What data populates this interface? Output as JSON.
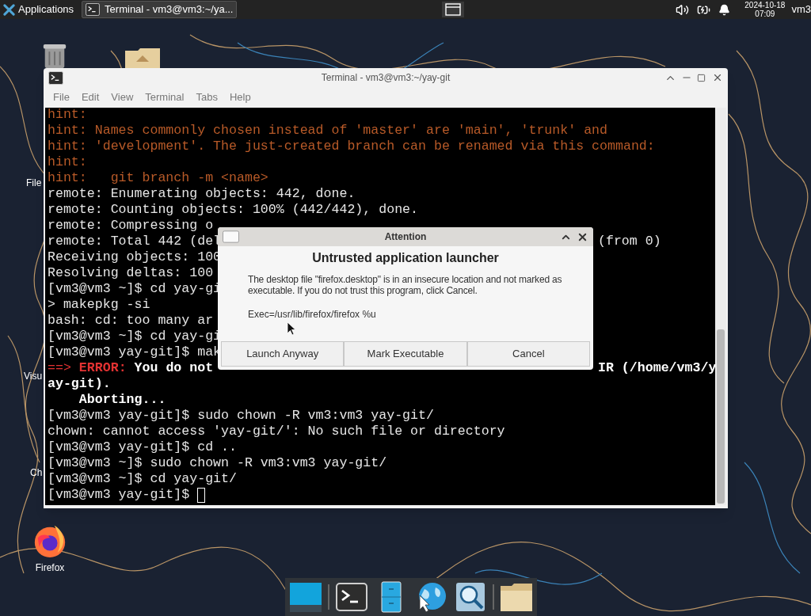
{
  "top_panel": {
    "menu_label": "Applications",
    "task": {
      "label": "Terminal - vm3@vm3:~/ya...",
      "selected": true
    },
    "date": "2024-10-18",
    "time": "07:09",
    "user": "vm3"
  },
  "desktop_icons": [
    {
      "kind": "trash"
    },
    {
      "kind": "folder"
    },
    {
      "kind": "label",
      "label": "File"
    },
    {
      "kind": "label",
      "label": "Visu"
    },
    {
      "kind": "label",
      "label": "Ch"
    },
    {
      "kind": "firefox",
      "label": "Firefox"
    }
  ],
  "terminal": {
    "title": "Terminal - vm3@vm3:~/yay-git",
    "menu": [
      "File",
      "Edit",
      "View",
      "Terminal",
      "Tabs",
      "Help"
    ],
    "lines": [
      {
        "segments": [
          {
            "kind": "hint",
            "text": "hint:"
          }
        ]
      },
      {
        "segments": [
          {
            "kind": "hint",
            "text": "hint: Names commonly chosen instead of 'master' are 'main', 'trunk' and"
          }
        ]
      },
      {
        "segments": [
          {
            "kind": "hint",
            "text": "hint: 'development'. The just-created branch can be renamed via this command:"
          }
        ]
      },
      {
        "segments": [
          {
            "kind": "hint",
            "text": "hint:"
          }
        ]
      },
      {
        "segments": [
          {
            "kind": "hint",
            "text": "hint:   git branch -m <name>"
          }
        ]
      },
      {
        "segments": [
          {
            "kind": "normal",
            "text": "remote: Enumerating objects: 442, done."
          }
        ]
      },
      {
        "segments": [
          {
            "kind": "normal",
            "text": "remote: Counting objects: 100% (442/442), done."
          }
        ]
      },
      {
        "segments": [
          {
            "kind": "normal",
            "text": "remote: Compressing o"
          }
        ]
      },
      {
        "segments": [
          {
            "kind": "normal",
            "text": "remote: Total 442 (del"
          }
        ],
        "tail": {
          "kind": "normal",
          "text": "(from 0)"
        }
      },
      {
        "segments": [
          {
            "kind": "normal",
            "text": "Receiving objects: 100"
          }
        ]
      },
      {
        "segments": [
          {
            "kind": "normal",
            "text": "Resolving deltas: 100"
          }
        ]
      },
      {
        "segments": [
          {
            "kind": "normal",
            "text": "[vm3@vm3 ~]$ cd yay-gi"
          }
        ]
      },
      {
        "segments": [
          {
            "kind": "normal",
            "text": "> makepkg -si"
          }
        ]
      },
      {
        "segments": [
          {
            "kind": "normal",
            "text": "bash: cd: too many ar"
          }
        ]
      },
      {
        "segments": [
          {
            "kind": "normal",
            "text": "[vm3@vm3 ~]$ cd yay-gi"
          }
        ]
      },
      {
        "segments": [
          {
            "kind": "normal",
            "text": "[vm3@vm3 yay-git]$ mak"
          }
        ]
      },
      {
        "segments": [
          {
            "kind": "red",
            "text": "==> "
          },
          {
            "kind": "redbold",
            "text": "ERROR:"
          },
          {
            "kind": "bold",
            "text": " You do not"
          }
        ],
        "tail": {
          "kind": "bold",
          "text": "IR (/home/vm3/y"
        }
      },
      {
        "segments": [
          {
            "kind": "bold",
            "text": "ay-git)."
          }
        ]
      },
      {
        "segments": [
          {
            "kind": "bold",
            "text": "    Aborting..."
          }
        ]
      },
      {
        "segments": [
          {
            "kind": "normal",
            "text": "[vm3@vm3 yay-git]$ sudo chown -R vm3:vm3 yay-git/"
          }
        ]
      },
      {
        "segments": [
          {
            "kind": "normal",
            "text": "chown: cannot access 'yay-git/': No such file or directory"
          }
        ]
      },
      {
        "segments": [
          {
            "kind": "normal",
            "text": "[vm3@vm3 yay-git]$ cd .."
          }
        ]
      },
      {
        "segments": [
          {
            "kind": "normal",
            "text": "[vm3@vm3 ~]$ sudo chown -R vm3:vm3 yay-git/"
          }
        ]
      },
      {
        "segments": [
          {
            "kind": "normal",
            "text": "[vm3@vm3 ~]$ cd yay-git/"
          }
        ]
      },
      {
        "segments": [
          {
            "kind": "normal",
            "text": "[vm3@vm3 yay-git]$ "
          }
        ],
        "cursor": true
      }
    ]
  },
  "dialog": {
    "title": "Attention",
    "heading": "Untrusted application launcher",
    "message": "The desktop file \"firefox.desktop\" is in an insecure location and not marked as executable. If you do not trust this program, click Cancel.",
    "exec": "Exec=/usr/lib/firefox/firefox %u",
    "buttons": [
      "Launch Anyway",
      "Mark Executable",
      "Cancel"
    ]
  },
  "dock": [
    {
      "kind": "desktop"
    },
    {
      "kind": "separator"
    },
    {
      "kind": "terminal"
    },
    {
      "kind": "files"
    },
    {
      "kind": "browser"
    },
    {
      "kind": "search"
    },
    {
      "kind": "separator"
    },
    {
      "kind": "folder"
    }
  ]
}
